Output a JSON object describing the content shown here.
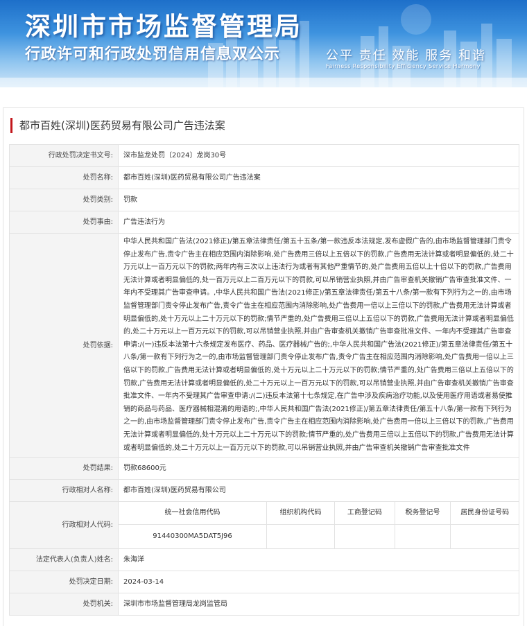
{
  "header": {
    "title": "深圳市市场监督管理局",
    "subtitle": "行政许可和行政处罚信用信息双公示",
    "slogan": "公平  责任  效能  服务  和谐",
    "slogan_en": "Fairness  Responsibility  Efficiency  Service  Harmony"
  },
  "case": {
    "title": "都市百姓(深圳)医药贸易有限公司广告违法案"
  },
  "fields": {
    "decision_no": {
      "label": "行政处罚决定书文号:",
      "value": "深市监龙处罚〔2024〕龙岗30号"
    },
    "case_name": {
      "label": "处罚名称:",
      "value": "都市百姓(深圳)医药贸易有限公司广告违法案"
    },
    "category": {
      "label": "处罚类别:",
      "value": "罚款"
    },
    "reason": {
      "label": "处罚事由:",
      "value": "广告违法行为"
    },
    "basis": {
      "label": "处罚依据:",
      "value": "中华人民共和国广告法(2021修正)/第五章法律责任/第五十五条/第一款违反本法规定,发布虚假广告的,由市场监督管理部门责令停止发布广告,责令广告主在相应范围内消除影响,处广告费用三倍以上五倍以下的罚款,广告费用无法计算或者明显偏低的,处二十万元以上一百万元以下的罚款;两年内有三次以上违法行为或者有其他严重情节的,处广告费用五倍以上十倍以下的罚款,广告费用无法计算或者明显偏低的,处一百万元以上二百万元以下的罚款,可以吊销营业执照,并由广告审查机关撤销广告审查批准文件、一年内不受理其广告审查申请。,中华人民共和国广告法(2021修正)/第五章法律责任/第五十八条/第一款有下列行为之一的,由市场监督管理部门责令停止发布广告,责令广告主在相应范围内消除影响,处广告费用一倍以上三倍以下的罚款,广告费用无法计算或者明显偏低的,处十万元以上二十万元以下的罚款;情节严重的,处广告费用三倍以上五倍以下的罚款,广告费用无法计算或者明显偏低的,处二十万元以上一百万元以下的罚款,可以吊销营业执照,并由广告审查机关撤销广告审查批准文件、一年内不受理其广告审查申请:/(一)违反本法第十六条规定发布医疗、药品、医疗器械广告的;,中华人民共和国广告法(2021修正)/第五章法律责任/第五十八条/第一款有下列行为之一的,由市场监督管理部门责令停止发布广告,责令广告主在相应范围内消除影响,处广告费用一倍以上三倍以下的罚款,广告费用无法计算或者明显偏低的,处十万元以上二十万元以下的罚款;情节严重的,处广告费用三倍以上五倍以下的罚款,广告费用无法计算或者明显偏低的,处二十万元以上一百万元以下的罚款,可以吊销营业执照,并由广告审查机关撤销广告审查批准文件、一年内不受理其广告审查申请:/(二)违反本法第十七条规定,在广告中涉及疾病治疗功能,以及使用医疗用语或者易使推销的商品与药品、医疗器械相混淆的用语的;,中华人民共和国广告法(2021修正)/第五章法律责任/第五十八条/第一款有下列行为之一的,由市场监督管理部门责令停止发布广告,责令广告主在相应范围内消除影响,处广告费用一倍以上三倍以下的罚款,广告费用无法计算或者明显偏低的,处十万元以上二十万元以下的罚款;情节严重的,处广告费用三倍以上五倍以下的罚款,广告费用无法计算或者明显偏低的,处二十万元以上一百万元以下的罚款,可以吊销营业执照,并由广告审查机关撤销广告审查批准文件"
    },
    "result": {
      "label": "处罚结果:",
      "value": "罚款68600元"
    },
    "party_name": {
      "label": "行政相对人名称:",
      "value": "都市百姓(深圳)医药贸易有限公司"
    },
    "party_code": {
      "label": "行政相对人代码:",
      "headers": [
        "统一社会信用代码",
        "组织机构代码",
        "工商登记码",
        "税务登记号",
        "居民身份证号码"
      ],
      "values": [
        "91440300MA5DAT5J96",
        "",
        "",
        "",
        ""
      ]
    },
    "legal_rep": {
      "label": "法定代表人(负责人)姓名:",
      "value": "朱海洋"
    },
    "decision_date": {
      "label": "处罚决定日期:",
      "value": "2024-03-14"
    },
    "authority": {
      "label": "处罚机关:",
      "value": "深圳市市场监督管理局龙岗监管局"
    }
  },
  "colors": {
    "title_marker": "#c2161b",
    "banner_top": "#1d6fc9",
    "label_bg": "#f4f4f4",
    "border": "#e2e2e2"
  }
}
